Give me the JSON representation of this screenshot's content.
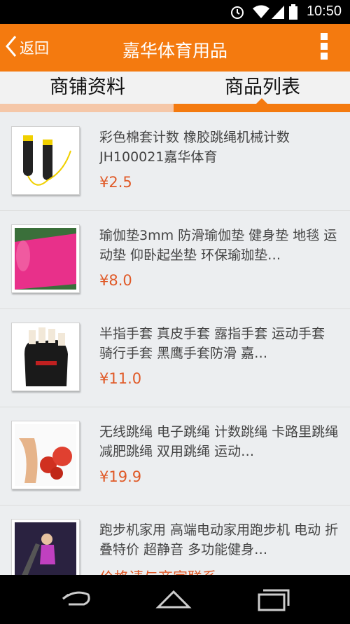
{
  "status": {
    "time": "10:50"
  },
  "header": {
    "back_label": "返回",
    "title": "嘉华体育用品"
  },
  "tabs": [
    {
      "label": "商铺资料"
    },
    {
      "label": "商品列表"
    }
  ],
  "products": [
    {
      "name": "彩色棉套计数 橡胶跳绳机械计数JH100021嘉华体育",
      "price": "¥2.5"
    },
    {
      "name": "瑜伽垫3mm 防滑瑜伽垫 健身垫 地毯 运动垫 仰卧起坐垫 环保瑜珈垫…",
      "price": "¥8.0"
    },
    {
      "name": "半指手套 真皮手套 露指手套 运动手套 骑行手套 黑鹰手套防滑 嘉…",
      "price": "¥11.0"
    },
    {
      "name": "无线跳绳 电子跳绳 计数跳绳 卡路里跳绳 减肥跳绳 双用跳绳 运动…",
      "price": "¥19.9"
    },
    {
      "name": "跑步机家用 高端电动家用跑步机 电动 折叠特价 超静音 多功能健身…",
      "price": "价格请与商家联系"
    }
  ],
  "colors": {
    "accent": "#f47a0f",
    "price": "#e05a28"
  }
}
